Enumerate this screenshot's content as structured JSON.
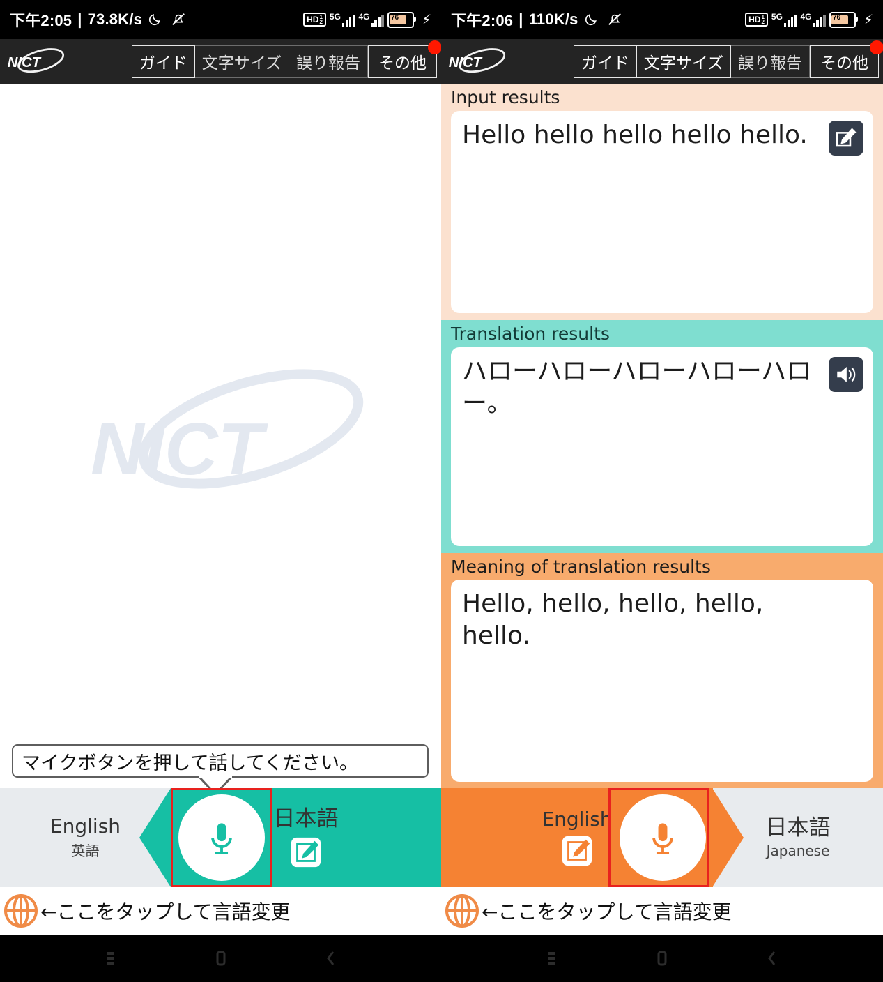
{
  "left_panel": {
    "status_bar": {
      "time": "下午2:05",
      "separator": "|",
      "network_speed": "73.8K/s",
      "moon_icon": "moon-icon",
      "mute_icon": "notifications-muted-icon",
      "hd_badge": "HD",
      "hd_sub_top": "1",
      "hd_sub_bottom": "2",
      "net_5g": "5G",
      "net_4g": "4G",
      "battery_level": "76",
      "charging_icon": "lightning-bolt-icon"
    },
    "header": {
      "logo": "nict-logo",
      "buttons": [
        {
          "label": "ガイド",
          "name": "guide-button"
        },
        {
          "label": "文字サイズ",
          "name": "font-size-button"
        },
        {
          "label": "誤り報告",
          "name": "error-report-button"
        },
        {
          "label": "その他",
          "name": "more-button",
          "badge": true
        }
      ]
    },
    "watermark": "nict-watermark",
    "tooltip": "マイクボタンを押して話してください。",
    "language_bar": {
      "source": {
        "name": "English",
        "sub": "英語"
      },
      "target": {
        "name": "日本語",
        "sub": "",
        "edit_icon": "edit-icon"
      },
      "mic_icon": "microphone-icon",
      "accent_color": "#16bfa4"
    },
    "hint": {
      "globe_icon": "globe-icon",
      "text": "←ここをタップして言語変更"
    }
  },
  "right_panel": {
    "status_bar": {
      "time": "下午2:06",
      "separator": "|",
      "network_speed": "110K/s",
      "moon_icon": "moon-icon",
      "mute_icon": "notifications-muted-icon",
      "hd_badge": "HD",
      "hd_sub_top": "1",
      "hd_sub_bottom": "2",
      "net_5g": "5G",
      "net_4g": "4G",
      "battery_level": "76",
      "charging_icon": "lightning-bolt-icon"
    },
    "header": {
      "logo": "nict-logo",
      "buttons": [
        {
          "label": "ガイド",
          "name": "guide-button"
        },
        {
          "label": "文字サイズ",
          "name": "font-size-button"
        },
        {
          "label": "誤り報告",
          "name": "error-report-button"
        },
        {
          "label": "その他",
          "name": "more-button",
          "badge": true
        }
      ]
    },
    "sections": {
      "input": {
        "label": "Input results",
        "text": "Hello hello hello hello hello.",
        "action_icon": "edit-icon",
        "background": "#fbe1cf"
      },
      "translation": {
        "label": "Translation results",
        "text": "ハローハローハローハローハロー。",
        "action_icon": "speaker-icon",
        "background": "#7fded0"
      },
      "meaning": {
        "label": "Meaning of translation results",
        "text": "Hello, hello, hello, hello, hello.",
        "background": "#f8ab6d"
      }
    },
    "language_bar": {
      "source": {
        "name": "English",
        "sub": "",
        "edit_icon": "edit-icon"
      },
      "target": {
        "name": "日本語",
        "sub": "Japanese"
      },
      "mic_icon": "microphone-icon",
      "accent_color": "#f58233"
    },
    "hint": {
      "globe_icon": "globe-icon",
      "text": "←ここをタップして言語変更"
    }
  },
  "nav_bar": {
    "buttons": [
      {
        "name": "recents-button",
        "icon": "recents-icon"
      },
      {
        "name": "home-button",
        "icon": "home-icon"
      },
      {
        "name": "back-button",
        "icon": "back-chevron-icon"
      }
    ]
  }
}
